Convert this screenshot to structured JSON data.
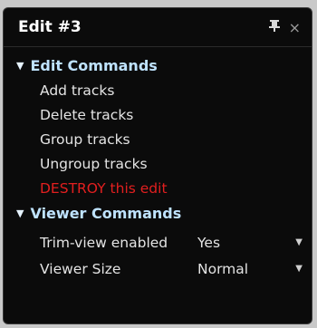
{
  "panel": {
    "title": "Edit #3",
    "pin_glyph": "†",
    "close_glyph": "×"
  },
  "sections": [
    {
      "title": "Edit Commands",
      "expanded_glyph": "▼",
      "items": [
        {
          "label": "Add tracks"
        },
        {
          "label": "Delete tracks"
        },
        {
          "label": "Group tracks"
        },
        {
          "label": "Ungroup tracks"
        },
        {
          "label": "DESTROY this edit"
        }
      ]
    },
    {
      "title": "Viewer Commands",
      "expanded_glyph": "▼",
      "settings": [
        {
          "label": "Trim-view enabled",
          "value": "Yes",
          "dropdown_glyph": "▼"
        },
        {
          "label": "Viewer Size",
          "value": "Normal",
          "dropdown_glyph": "▼"
        }
      ]
    }
  ],
  "colors": {
    "background": "#0b0b0b",
    "section_header": "#bfe3ff",
    "item_text": "#e4e4e4",
    "danger_text": "#e21f1f"
  },
  "icons": {
    "pin": "pin-icon",
    "close": "close-icon",
    "expand": "triangle-down-icon",
    "dropdown": "chevron-down-icon"
  }
}
